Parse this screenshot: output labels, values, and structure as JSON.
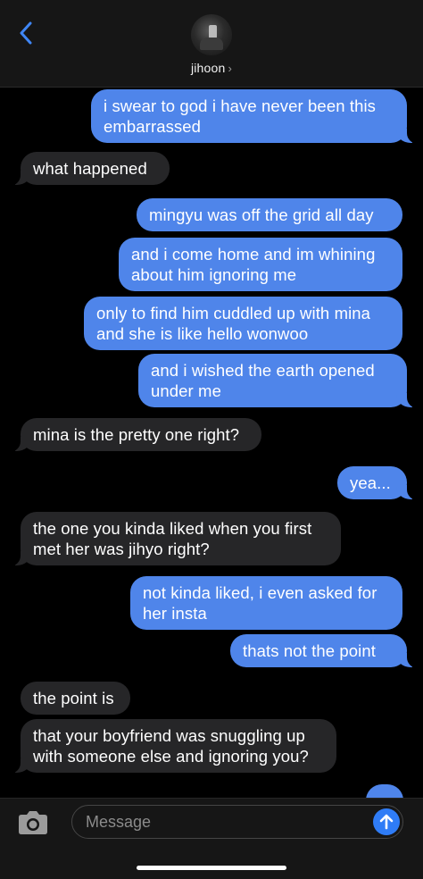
{
  "header": {
    "contact_name": "jihoon",
    "chevron": "›"
  },
  "colors": {
    "sent_bubble": "#4f85ea",
    "received_bubble": "#262628",
    "accent": "#2f7cf6"
  },
  "messages": [
    {
      "side": "sent",
      "text": "i swear to god i have never been this\nembarrassed"
    },
    {
      "side": "received",
      "text": "what happened"
    },
    {
      "side": "sent",
      "text": "mingyu was off the grid all day"
    },
    {
      "side": "sent",
      "text": "and i come home and im whining\nabout him ignoring me"
    },
    {
      "side": "sent",
      "text": "only to find him cuddled up with mina\nand she is like hello wonwoo"
    },
    {
      "side": "sent",
      "text": "and i wished the earth opened\nunder me"
    },
    {
      "side": "received",
      "text": "mina is the pretty one right?"
    },
    {
      "side": "sent",
      "text": "yea..."
    },
    {
      "side": "received",
      "text": "the one you kinda liked when you first\nmet her was jihyo right?"
    },
    {
      "side": "sent",
      "text": "not kinda liked, i even asked for\nher insta"
    },
    {
      "side": "sent",
      "text": "thats not the point"
    },
    {
      "side": "received",
      "text": "the point is"
    },
    {
      "side": "received",
      "text": "that your boyfriend was snuggling up\nwith someone else and ignoring you?"
    }
  ],
  "composer": {
    "placeholder": "Message",
    "camera_icon": "camera-icon",
    "send_icon": "arrow-up-icon"
  }
}
